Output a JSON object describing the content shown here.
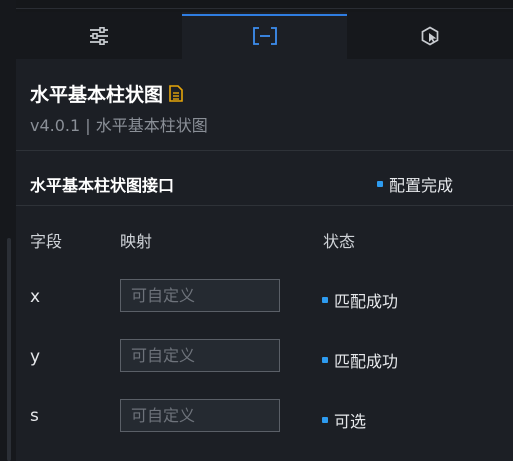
{
  "tabs": [
    {
      "icon": "sliders-icon",
      "active": false
    },
    {
      "icon": "data-bracket-icon",
      "active": true
    },
    {
      "icon": "interaction-icon",
      "active": false
    }
  ],
  "header": {
    "title": "水平基本柱状图",
    "title_icon": "document-icon",
    "subtitle": "v4.0.1 | 水平基本柱状图"
  },
  "interface": {
    "title": "水平基本柱状图接口",
    "status": "配置完成"
  },
  "table": {
    "columns": [
      "字段",
      "映射",
      "状态"
    ],
    "rows": [
      {
        "field": "x",
        "placeholder": "可自定义",
        "value": "",
        "status": "匹配成功"
      },
      {
        "field": "y",
        "placeholder": "可自定义",
        "value": "",
        "status": "匹配成功"
      },
      {
        "field": "s",
        "placeholder": "可自定义",
        "value": "",
        "status": "可选"
      }
    ]
  },
  "colors": {
    "accent": "#2f7de1",
    "status_dot": "#2d9bf0",
    "title_icon": "#e5a50a",
    "background": "#1c1f25"
  }
}
